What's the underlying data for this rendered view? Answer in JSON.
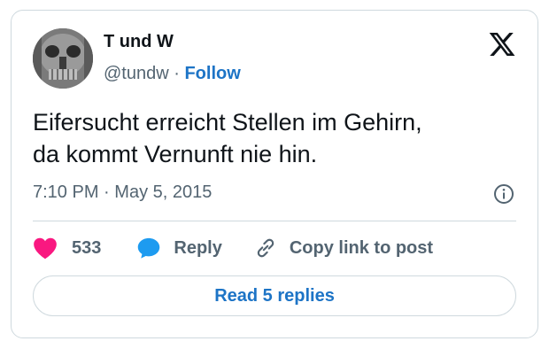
{
  "author": {
    "name": "T und W",
    "handle": "@tundw",
    "separator": "·",
    "follow_label": "Follow"
  },
  "tweet": {
    "lines": [
      "Eifersucht erreicht Stellen im Gehirn,",
      "da kommt Vernunft nie hin."
    ]
  },
  "meta": {
    "time": "7:10 PM",
    "separator": "·",
    "date": "May 5, 2015"
  },
  "actions": {
    "like_count": "533",
    "reply_label": "Reply",
    "copy_label": "Copy link to post"
  },
  "read_replies_label": "Read 5 replies",
  "colors": {
    "like": "#f91880",
    "reply": "#1d9bf0",
    "link": "#1d74c6",
    "text": "#0f1419",
    "muted": "#536471"
  },
  "icons": [
    "x-logo-icon",
    "info-icon",
    "heart-icon",
    "reply-bubble-icon",
    "link-icon"
  ]
}
